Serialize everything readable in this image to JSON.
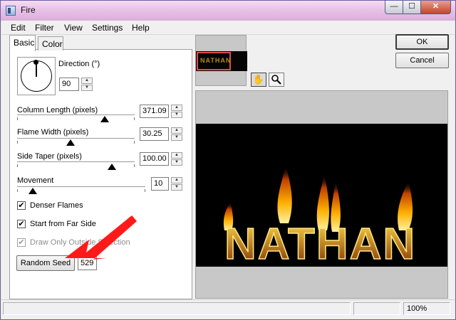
{
  "window": {
    "title": "Fire"
  },
  "titlebar_buttons": {
    "minimize": "—",
    "maximize": "☐",
    "close": "✕"
  },
  "menu": [
    "Edit",
    "Filter",
    "View",
    "Settings",
    "Help"
  ],
  "tabs": [
    {
      "label": "Basic",
      "active": true
    },
    {
      "label": "Color",
      "active": false
    }
  ],
  "direction": {
    "label": "Direction (°)",
    "value": "90"
  },
  "sliders": [
    {
      "label": "Column Length (pixels)",
      "value": "371.09",
      "level": 0.72
    },
    {
      "label": "Flame Width (pixels)",
      "value": "30.25",
      "level": 0.45
    },
    {
      "label": "Side Taper (pixels)",
      "value": "100.00",
      "level": 0.77
    },
    {
      "label": "Movement",
      "value": "10",
      "level": 0.1
    }
  ],
  "checkboxes": [
    {
      "label": "Denser Flames",
      "checked": true,
      "enabled": true
    },
    {
      "label": "Start from Far Side",
      "checked": true,
      "enabled": true
    },
    {
      "label": "Draw Only Outside Selection",
      "checked": true,
      "enabled": false
    }
  ],
  "random_seed": {
    "label": "Random Seed",
    "value": "529"
  },
  "buttons": {
    "ok": "OK",
    "cancel": "Cancel"
  },
  "preview_text": "NATHAN",
  "thumb_text": "NATHAN",
  "status": {
    "zoom": "100%"
  },
  "colors": {
    "titlebar": "#e8c2e6",
    "annotation_arrow": "#ff1a1a",
    "flame": "#ffb000"
  },
  "icons": {
    "hand": "hand-icon",
    "zoom": "magnifier-icon",
    "app": "fire-app-icon"
  }
}
